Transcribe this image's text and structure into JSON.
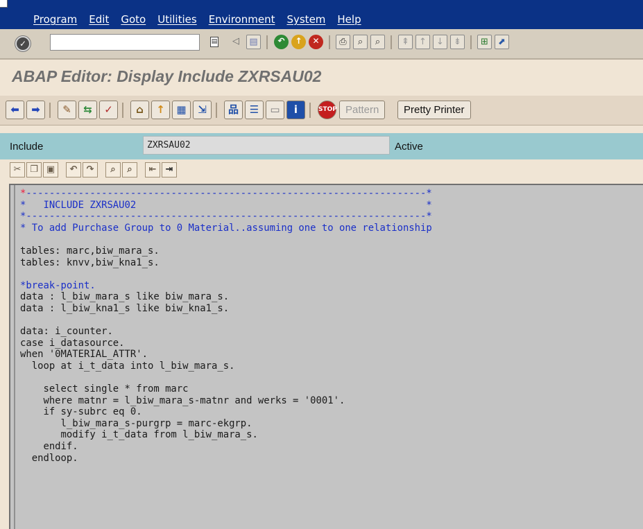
{
  "menu": [
    "Program",
    "Edit",
    "Goto",
    "Utilities",
    "Environment",
    "System",
    "Help"
  ],
  "toolbar": {
    "command_field_value": "",
    "icons": [
      "enter-icon",
      "back-icon",
      "exit-icon",
      "cancel-icon",
      "print-icon",
      "find-icon",
      "find-next-icon",
      "first-page-icon",
      "previous-page-icon",
      "next-page-icon",
      "last-page-icon",
      "create-session-icon",
      "shortcut-icon"
    ]
  },
  "title": "ABAP Editor: Display Include ZXRSAU02",
  "app_toolbar": {
    "pattern_label": "Pattern",
    "pretty_printer_label": "Pretty Printer"
  },
  "header": {
    "label": "Include",
    "value": "ZXRSAU02",
    "status": "Active"
  },
  "colors": {
    "menu_bar": "#0b3286",
    "header_strip": "#99c9cf",
    "editor_bg": "#c4c4c4",
    "comment": "#1a2fc8"
  },
  "code_lines": [
    "*---------------------------------------------------------------------*",
    "*   INCLUDE ZXRSAU02                                                  *",
    "*---------------------------------------------------------------------*",
    "* To add Purchase Group to 0 Material..assuming one to one relationship",
    "",
    "tables: marc,biw_mara_s.",
    "tables: knvv,biw_kna1_s.",
    "",
    "*break-point.",
    "data : l_biw_mara_s like biw_mara_s.",
    "data : l_biw_kna1_s like biw_kna1_s.",
    "",
    "data: i_counter.",
    "case i_datasource.",
    "when '0MATERIAL_ATTR'.",
    "  loop at i_t_data into l_biw_mara_s.",
    "",
    "    select single * from marc",
    "    where matnr = l_biw_mara_s-matnr and werks = '0001'.",
    "    if sy-subrc eq 0.",
    "       l_biw_mara_s-purgrp = marc-ekgrp.",
    "       modify i_t_data from l_biw_mara_s.",
    "    endif.",
    "  endloop."
  ]
}
